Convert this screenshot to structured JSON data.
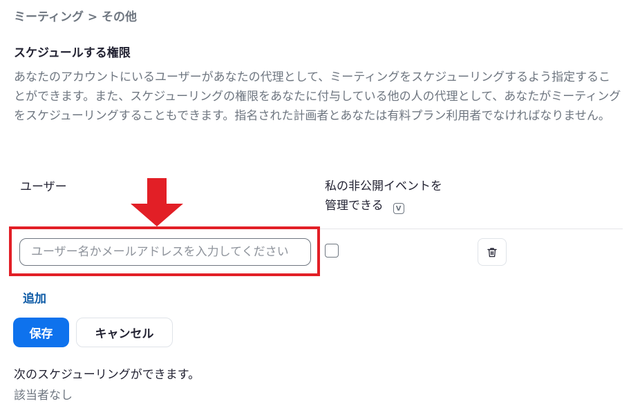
{
  "breadcrumb": "ミーティング > その他",
  "section": {
    "title": "スケジュールする権限",
    "description": "あなたのアカウントにいるユーザーがあなたの代理として、ミーティングをスケジューリングするよう指定することができます。また、スケジューリングの権限をあなたに付与している他の人の代理として、あなたがミーティングをスケジューリングすることもできます。指名された計画者とあなたは有料プラン利用者でなければなりません。"
  },
  "table": {
    "col_user": "ユーザー",
    "col_private_line1": "私の非公開イベントを",
    "col_private_line2": "管理できる",
    "info_icon_glyph": "V",
    "input_placeholder": "ユーザー名かメールアドレスを入力してください",
    "checkbox_checked": false
  },
  "icons": {
    "info": "info-icon",
    "delete": "trash-icon",
    "arrow": "down-arrow-icon"
  },
  "actions": {
    "add_label": "追加",
    "save_label": "保存",
    "cancel_label": "キャンセル"
  },
  "schedulable": {
    "title": "次のスケジューリングができます。",
    "none": "該当者なし"
  },
  "colors": {
    "accent": "#0e72ed",
    "link": "#0e5ba6",
    "highlight": "#e21f26",
    "muted_text": "#6e7680"
  }
}
